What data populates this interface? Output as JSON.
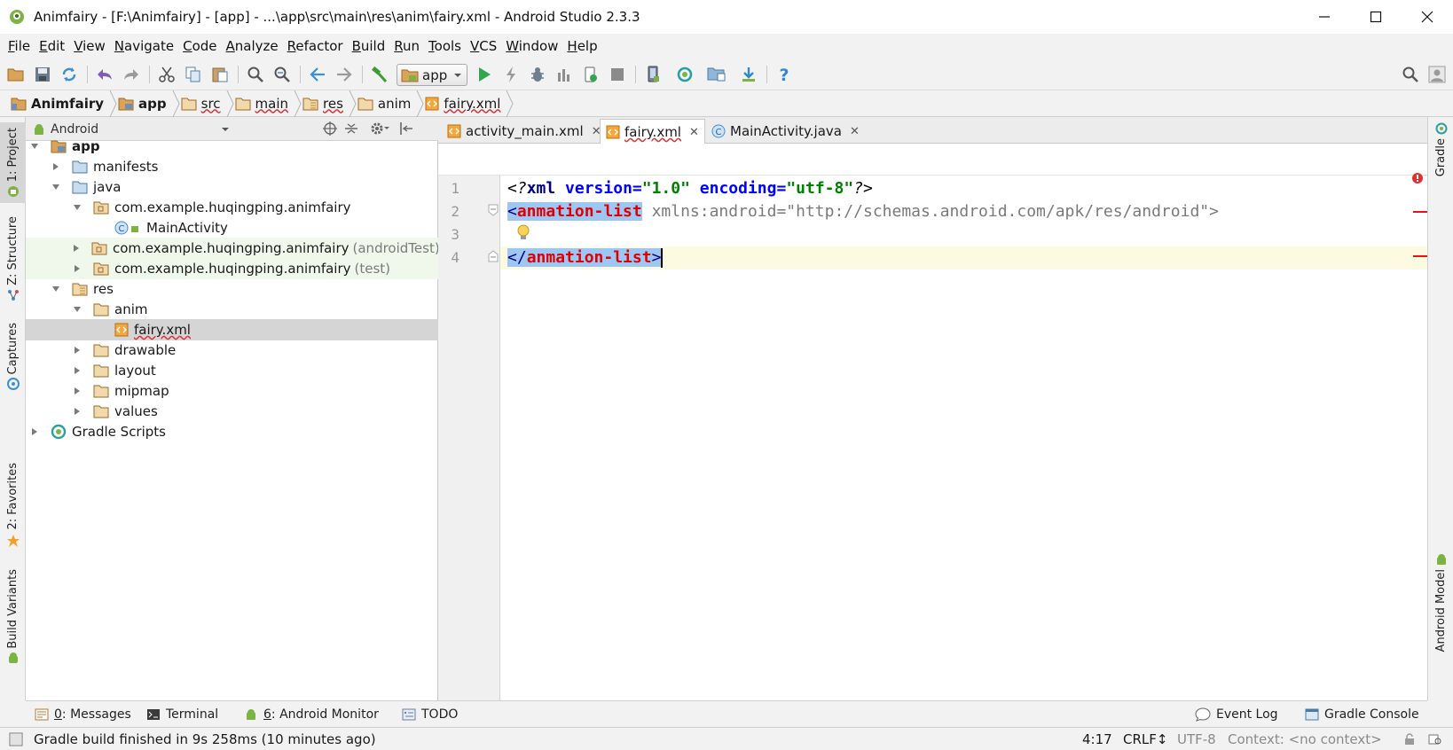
{
  "window": {
    "title": "Animfairy - [F:\\Animfairy] - [app] - ...\\app\\src\\main\\res\\anim\\fairy.xml - Android Studio 2.3.3"
  },
  "menu": [
    "File",
    "Edit",
    "View",
    "Navigate",
    "Code",
    "Analyze",
    "Refactor",
    "Build",
    "Run",
    "Tools",
    "VCS",
    "Window",
    "Help"
  ],
  "toolbar": {
    "run_config": "app",
    "icons": [
      "open-icon",
      "save-icon",
      "sync-icon",
      "undo-icon",
      "redo-icon",
      "cut-icon",
      "copy-icon",
      "paste-icon",
      "find-icon",
      "replace-icon",
      "back-icon",
      "forward-icon",
      "build-hammer-icon",
      "run-icon",
      "apply-changes-icon",
      "debug-icon",
      "profile-icon",
      "attach-debugger-icon",
      "stop-icon",
      "avd-manager-icon",
      "sync-gradle-icon",
      "project-structure-icon",
      "sdk-manager-icon",
      "help-icon",
      "search-everywhere-icon",
      "user-icon"
    ]
  },
  "breadcrumb": [
    "Animfairy",
    "app",
    "src",
    "main",
    "res",
    "anim",
    "fairy.xml"
  ],
  "left_strip": {
    "project": "1: Project",
    "structure": "Z: Structure",
    "captures": "Captures",
    "favorites": "2: Favorites",
    "build_variants": "Build Variants"
  },
  "right_strip": {
    "gradle": "Gradle",
    "android_model": "Android Model"
  },
  "project_panel": {
    "view_mode": "Android",
    "tree": [
      {
        "label": "app",
        "suffix": ""
      },
      {
        "label": "manifests",
        "suffix": ""
      },
      {
        "label": "java",
        "suffix": ""
      },
      {
        "label": "com.example.huqingping.animfairy",
        "suffix": ""
      },
      {
        "label": "MainActivity",
        "suffix": ""
      },
      {
        "label": "com.example.huqingping.animfairy",
        "suffix": "(androidTest)"
      },
      {
        "label": "com.example.huqingping.animfairy",
        "suffix": "(test)"
      },
      {
        "label": "res",
        "suffix": ""
      },
      {
        "label": "anim",
        "suffix": ""
      },
      {
        "label": "fairy.xml",
        "suffix": ""
      },
      {
        "label": "drawable",
        "suffix": ""
      },
      {
        "label": "layout",
        "suffix": ""
      },
      {
        "label": "mipmap",
        "suffix": ""
      },
      {
        "label": "values",
        "suffix": ""
      },
      {
        "label": "Gradle Scripts",
        "suffix": ""
      }
    ]
  },
  "editor": {
    "tabs": [
      "activity_main.xml",
      "fairy.xml",
      "MainActivity.java"
    ],
    "active_tab": "fairy.xml",
    "line_numbers": [
      "1",
      "2",
      "3",
      "4"
    ],
    "line1": {
      "open": "<?",
      "xml": "xml",
      "attr1": "version",
      "eq1": "=",
      "val1": "\"1.0\"",
      "attr2": "encoding",
      "eq2": "=",
      "val2": "\"utf-8\"",
      "close": "?>"
    },
    "line2": {
      "lt": "<",
      "tag": "anmation-list",
      "rest": " xmlns:android=\"http://schemas.android.com/apk/res/android\">"
    },
    "line4": {
      "lt": "</",
      "tag": "anmation-list",
      "gt": ">"
    }
  },
  "bottom_tools": {
    "messages_num": "0",
    "messages": ": Messages",
    "terminal": "Terminal",
    "monitor_num": "6",
    "monitor": ": Android Monitor",
    "todo": "TODO",
    "event_log": "Event Log",
    "gradle_console": "Gradle Console"
  },
  "status": {
    "message": "Gradle build finished in 9s 258ms (10 minutes ago)",
    "position": "4:17",
    "line_sep": "CRLF↕",
    "encoding": "UTF-8",
    "context": "Context: <no context>"
  },
  "colors": {
    "selection": "#9ec6f2",
    "error": "#e10000",
    "xml_attr": "#0000ff",
    "xml_value": "#008000",
    "current_line": "#fcfae1"
  }
}
